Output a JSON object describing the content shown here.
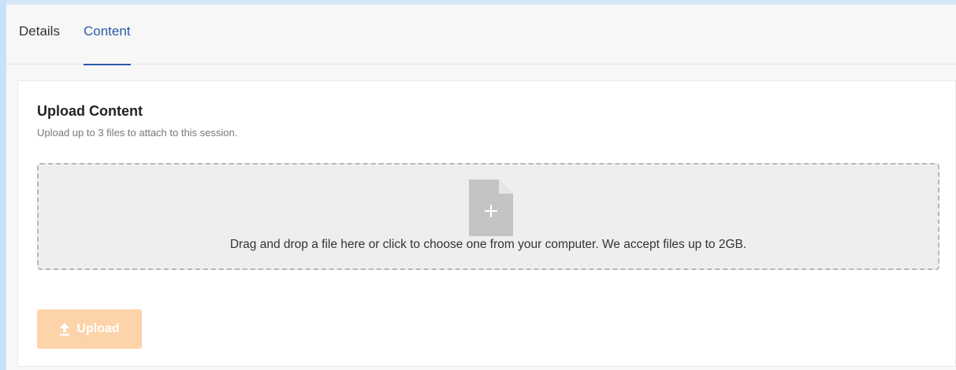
{
  "tabs": [
    {
      "label": "Details",
      "active": false
    },
    {
      "label": "Content",
      "active": true
    }
  ],
  "upload_section": {
    "title": "Upload Content",
    "subtitle": "Upload up to 3 files to attach to this session.",
    "dropzone_text": "Drag and drop a file here or click to choose one from your computer. We accept files up to 2GB.",
    "dropzone_icon": "file-add-icon",
    "upload_button_label": "Upload",
    "upload_button_icon": "upload-arrow-icon",
    "upload_button_state": "disabled"
  },
  "colors": {
    "active_tab": "#2a5aa8",
    "upload_button_disabled": "#fdd3a9",
    "dropzone_bg": "#eeeeee"
  }
}
